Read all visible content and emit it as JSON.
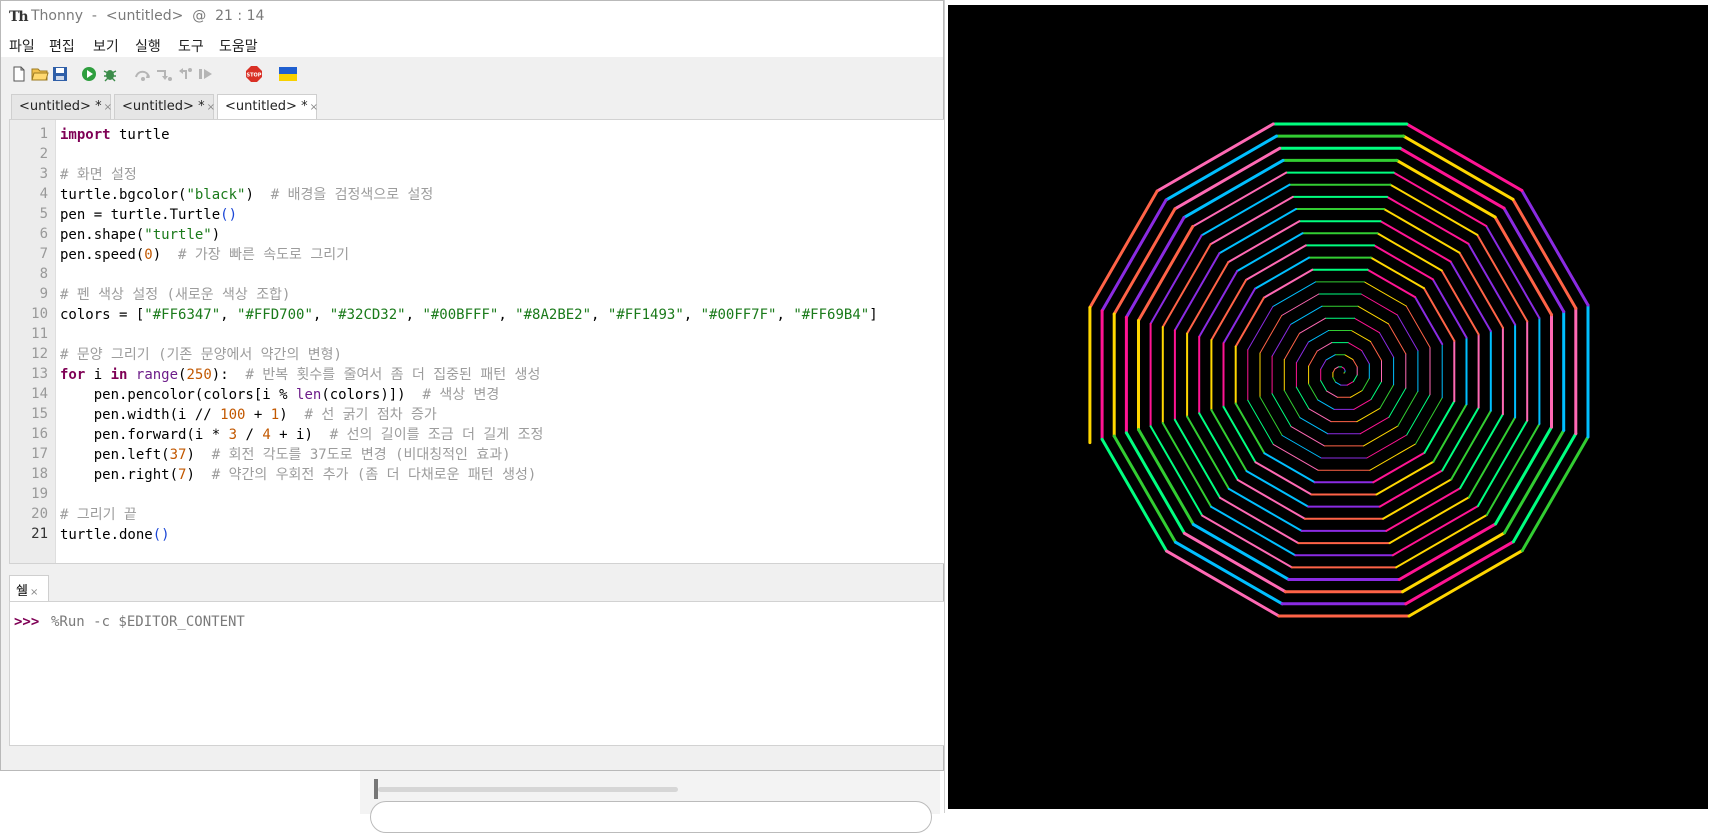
{
  "window": {
    "logo": "Th",
    "title": "Thonny  -  <untitled>  @  21 : 14"
  },
  "menu": [
    "파일",
    "편집",
    "보기",
    "실행",
    "도구",
    "도움말"
  ],
  "toolbar": {
    "icons": [
      "new-file-icon",
      "open-folder-icon",
      "save-icon",
      "run-icon",
      "debug-icon",
      "step-over-icon",
      "step-into-icon",
      "step-out-icon",
      "resume-icon",
      "stop-icon",
      "ukraine-flag-icon"
    ],
    "stop_label": "STOP"
  },
  "tabs": [
    {
      "label": "<untitled> *",
      "close": "×"
    },
    {
      "label": "<untitled> *",
      "close": "×"
    },
    {
      "label": "<untitled> *",
      "close": "×"
    }
  ],
  "editor": {
    "current_line": 21,
    "lines": [
      "import turtle",
      "",
      "# 화면 설정",
      "turtle.bgcolor(\"black\")  # 배경을 검정색으로 설정",
      "pen = turtle.Turtle()",
      "pen.shape(\"turtle\")",
      "pen.speed(0)  # 가장 빠른 속도로 그리기",
      "",
      "# 펜 색상 설정 (새로운 색상 조합)",
      "colors = [\"#FF6347\", \"#FFD700\", \"#32CD32\", \"#00BFFF\", \"#8A2BE2\", \"#FF1493\", \"#00FF7F\", \"#FF69B4\"]",
      "",
      "# 문양 그리기 (기존 문양에서 약간의 변형)",
      "for i in range(250):  # 반복 횟수를 줄여서 좀 더 집중된 패턴 생성",
      "    pen.pencolor(colors[i % len(colors)])  # 색상 변경",
      "    pen.width(i // 100 + 1)  # 선 굵기 점차 증가",
      "    pen.forward(i * 3 / 4 + i)  # 선의 길이를 조금 더 길게 조정",
      "    pen.left(37)  # 회전 각도를 37도로 변경 (비대칭적인 효과)",
      "    pen.right(7)  # 약간의 우회전 추가 (좀 더 다채로운 패턴 생성)",
      "",
      "# 그리기 끝",
      "turtle.done()"
    ]
  },
  "shell": {
    "tab_label": "쉘",
    "close": "×",
    "prompt": ">>>",
    "command": "%Run -c $EDITOR_CONTENT"
  },
  "turtle": {
    "background": "#000000",
    "colors": [
      "#FF6347",
      "#FFD700",
      "#32CD32",
      "#00BFFF",
      "#8A2BE2",
      "#FF1493",
      "#00FF7F",
      "#FF69B4"
    ],
    "steps": 250,
    "turn_degrees": 30
  }
}
